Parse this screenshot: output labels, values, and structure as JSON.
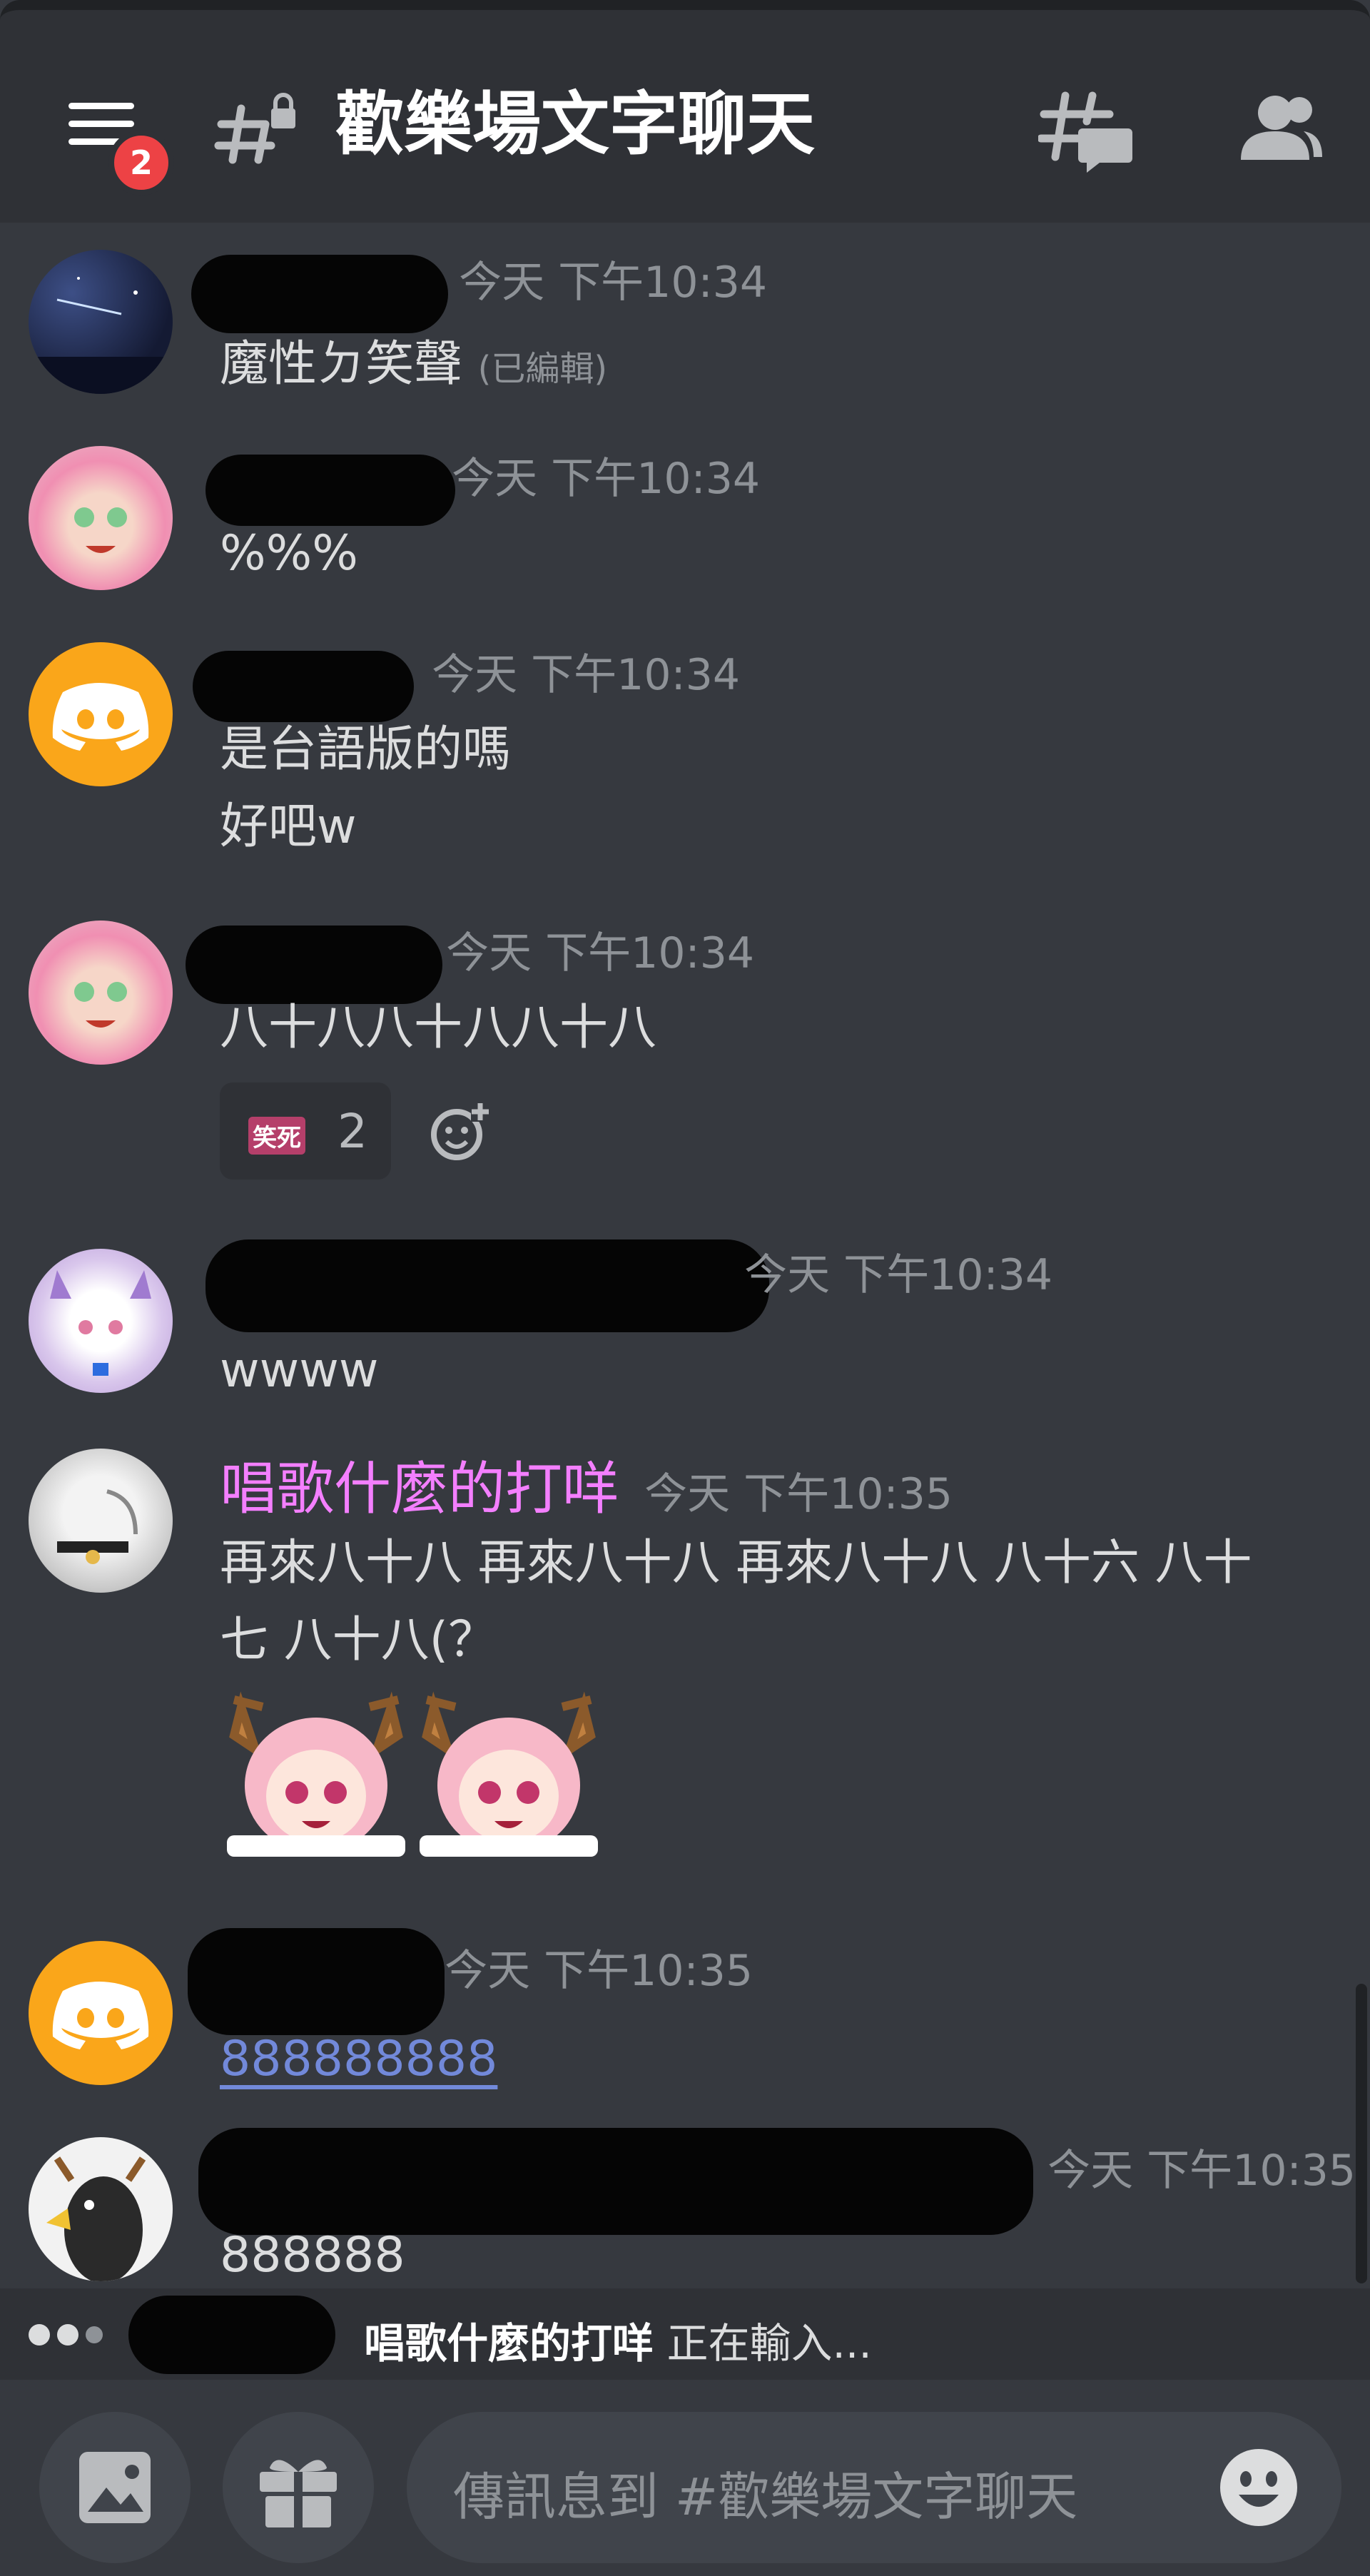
{
  "header": {
    "notification_count": "2",
    "channel_title": "歡樂場文字聊天"
  },
  "messages": [
    {
      "time": "今天 下午10:34",
      "lines": [
        "魔性ㄉ笑聲"
      ],
      "edited": "(已編輯)"
    },
    {
      "time": "今天 下午10:34",
      "lines": [
        "%%%"
      ]
    },
    {
      "time": "今天 下午10:34",
      "lines": [
        "是台語版的嗎",
        "好吧w"
      ]
    },
    {
      "time": "今天 下午10:34",
      "lines": [
        "八十八八十八八十八"
      ],
      "reaction": {
        "emoji": "笑死",
        "count": "2"
      }
    },
    {
      "time": "今天 下午10:34",
      "lines": [
        "wwww"
      ]
    },
    {
      "username": "唱歌什麼的打咩",
      "time": "今天 下午10:35",
      "lines": [
        "再來八十八 再來八十八 再來八十八 八十六 八十",
        "七 八十八(？"
      ]
    },
    {
      "time": "今天 下午10:35",
      "lines": [
        "888888888"
      ]
    },
    {
      "time": "今天 下午10:35",
      "lines": [
        "888888"
      ]
    }
  ],
  "typing": {
    "name": "唱歌什麼的打咩",
    "text": " 正在輸入..."
  },
  "composer": {
    "placeholder": "傳訊息到 #歡樂場文字聊天"
  },
  "colors": {
    "username_pink": "#f47fff",
    "link": "#7289da",
    "discord_orange": "#faa61a",
    "badge_red": "#ed4245"
  }
}
